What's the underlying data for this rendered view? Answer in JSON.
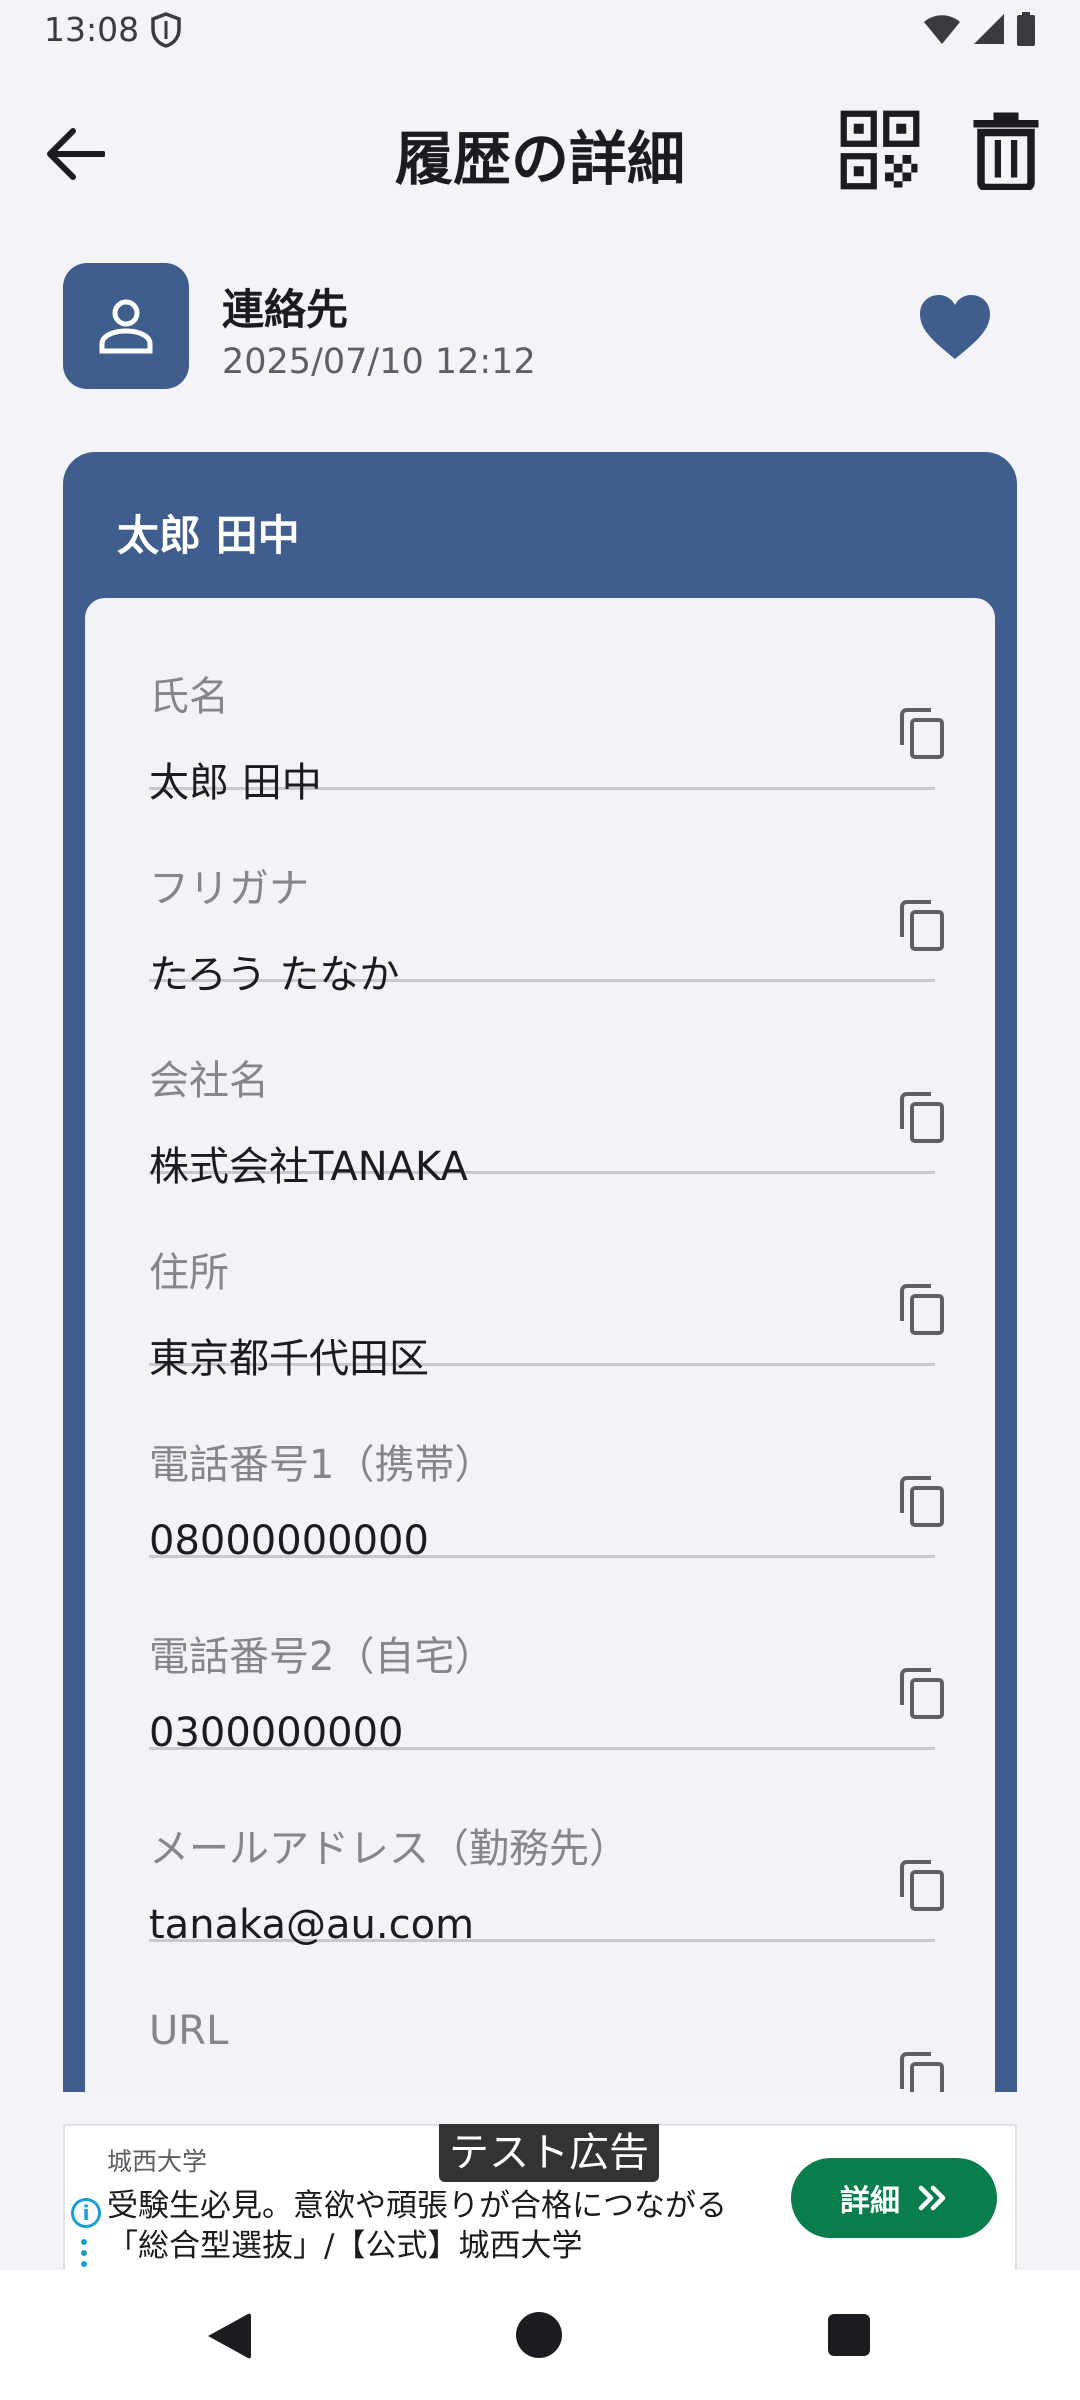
{
  "status_bar": {
    "time": "13:08"
  },
  "app_bar": {
    "title": "履歴の詳細"
  },
  "header": {
    "type_label": "連絡先",
    "date": "2025/07/10 12:12",
    "favorited": true
  },
  "card": {
    "title": "太郎 田中",
    "fields": [
      {
        "label": "氏名",
        "value": "太郎 田中"
      },
      {
        "label": "フリガナ",
        "value": "たろう たなか"
      },
      {
        "label": "会社名",
        "value": "株式会社TANAKA"
      },
      {
        "label": "住所",
        "value": "東京都千代田区"
      },
      {
        "label": "電話番号1（携帯）",
        "value": "08000000000"
      },
      {
        "label": "電話番号2（自宅）",
        "value": "0300000000"
      },
      {
        "label": "メールアドレス（勤務先）",
        "value": "tanaka@au.com"
      },
      {
        "label": "URL",
        "value": ""
      }
    ]
  },
  "ad": {
    "badge": "テスト広告",
    "advertiser": "城西大学",
    "line1": "受験生必見。意欲や頑張りが合格につながる",
    "line2": "「総合型選抜」/【公式】城西大学",
    "cta": "詳細"
  },
  "colors": {
    "accent": "#3f5e8e",
    "background": "#f4f3f8",
    "card_inner": "#f3f2f7",
    "cta": "#0a7d4d"
  }
}
